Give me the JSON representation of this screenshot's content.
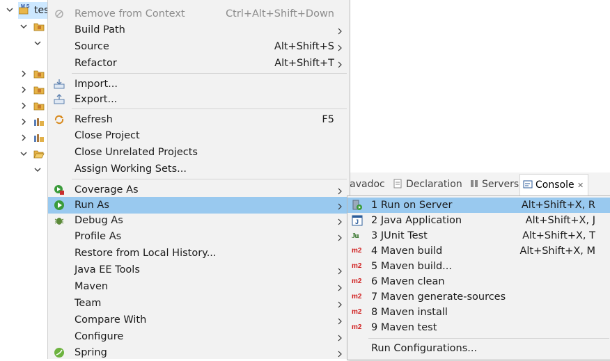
{
  "tree": {
    "root_label": "test",
    "root_icon_text": "M S"
  },
  "tabs": {
    "javadoc": "Javadoc",
    "declaration": "Declaration",
    "servers": "Servers",
    "console": "Console",
    "close_glyph": "✕"
  },
  "menu": {
    "items": [
      {
        "label": "Remove from Context",
        "shortcut": "Ctrl+Alt+Shift+Down",
        "disabled": true,
        "icon": "remove-context-icon"
      },
      {
        "label": "Build Path",
        "shortcut": "",
        "submenu": true
      },
      {
        "label": "Source",
        "shortcut": "Alt+Shift+S",
        "submenu": true
      },
      {
        "label": "Refactor",
        "shortcut": "Alt+Shift+T",
        "submenu": true
      },
      {
        "label": "Import...",
        "icon": "import-icon"
      },
      {
        "label": "Export...",
        "icon": "export-icon"
      },
      {
        "label": "Refresh",
        "shortcut": "F5",
        "icon": "refresh-icon"
      },
      {
        "label": "Close Project"
      },
      {
        "label": "Close Unrelated Projects"
      },
      {
        "label": "Assign Working Sets..."
      },
      {
        "label": "Coverage As",
        "submenu": true,
        "icon": "coverage-icon"
      },
      {
        "label": "Run As",
        "submenu": true,
        "icon": "run-icon",
        "selected": true
      },
      {
        "label": "Debug As",
        "submenu": true,
        "icon": "debug-icon"
      },
      {
        "label": "Profile As",
        "submenu": true
      },
      {
        "label": "Restore from Local History..."
      },
      {
        "label": "Java EE Tools",
        "submenu": true
      },
      {
        "label": "Maven",
        "submenu": true
      },
      {
        "label": "Team",
        "submenu": true
      },
      {
        "label": "Compare With",
        "submenu": true
      },
      {
        "label": "Configure",
        "submenu": true
      },
      {
        "label": "Spring",
        "submenu": true,
        "icon": "spring-icon"
      }
    ]
  },
  "submenu": {
    "items": [
      {
        "label": "1 Run on Server",
        "shortcut": "Alt+Shift+X, R",
        "icon": "server-run-icon",
        "selected": true
      },
      {
        "label": "2 Java Application",
        "shortcut": "Alt+Shift+X, J",
        "icon": "java-app-icon"
      },
      {
        "label": "3 JUnit Test",
        "shortcut": "Alt+Shift+X, T",
        "icon": "junit-icon",
        "icon_text": "Ju"
      },
      {
        "label": "4 Maven build",
        "shortcut": "Alt+Shift+X, M",
        "icon": "maven-icon",
        "icon_text": "m2"
      },
      {
        "label": "5 Maven build...",
        "icon": "maven-icon",
        "icon_text": "m2"
      },
      {
        "label": "6 Maven clean",
        "icon": "maven-icon",
        "icon_text": "m2"
      },
      {
        "label": "7 Maven generate-sources",
        "icon": "maven-icon",
        "icon_text": "m2"
      },
      {
        "label": "8 Maven install",
        "icon": "maven-icon",
        "icon_text": "m2"
      },
      {
        "label": "9 Maven test",
        "icon": "maven-icon",
        "icon_text": "m2"
      },
      {
        "label": "Run Configurations..."
      }
    ]
  },
  "colors": {
    "selection": "#99c9ef",
    "menu_bg": "#f2f2f2",
    "maven_red": "#d01f1f",
    "run_green": "#3a9b3a"
  }
}
